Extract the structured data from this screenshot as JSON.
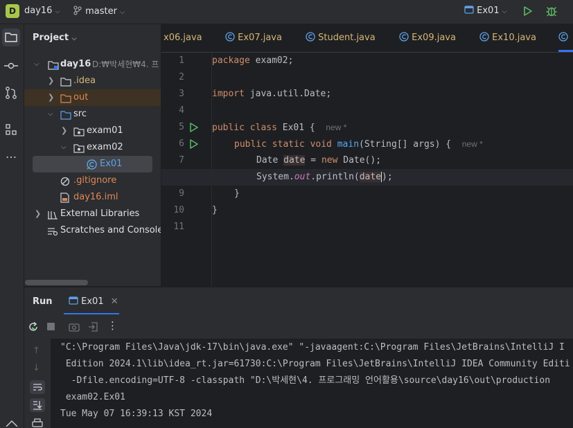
{
  "titlebar": {
    "project_badge": "D",
    "project_name": "day16",
    "branch": "master",
    "run_config": "Ex01"
  },
  "project_panel": {
    "title": "Project",
    "tree": [
      {
        "label": "day16",
        "path_hint": "D:₩박세현₩4. 프",
        "icon": "module-folder-icon"
      },
      {
        "label": ".idea",
        "icon": "folder-icon"
      },
      {
        "label": "out",
        "icon": "folder-icon"
      },
      {
        "label": "src",
        "icon": "folder-icon"
      },
      {
        "label": "exam01",
        "icon": "package-icon"
      },
      {
        "label": "exam02",
        "icon": "package-icon"
      },
      {
        "label": "Ex01",
        "icon": "class-icon"
      },
      {
        "label": ".gitignore",
        "icon": "ignore-file-icon"
      },
      {
        "label": "day16.iml",
        "icon": "iml-file-icon"
      },
      {
        "label": "External Libraries",
        "icon": "library-icon"
      },
      {
        "label": "Scratches and Consoles",
        "icon": "scratches-icon"
      }
    ]
  },
  "editor": {
    "tabs": [
      "x06.java",
      "Ex07.java",
      "Student.java",
      "Ex09.java",
      "Ex10.java"
    ],
    "line_numbers": [
      "1",
      "2",
      "3",
      "4",
      "5",
      "6",
      "7",
      "8",
      "9",
      "10",
      "11"
    ],
    "code": {
      "l1_kw": "package",
      "l1_rest": " exam02;",
      "l3_kw": "import",
      "l3_rest": " java.util.Date;",
      "l5_kw": "public class",
      "l5_rest": " Ex01 {",
      "l5_hint": "new *",
      "l6_kw": "public static void",
      "l6_fn": "main",
      "l6_rest": "(String[] args) {",
      "l6_hint": "new *",
      "l7_a": "Date ",
      "l7_var": "date",
      "l7_b": " = ",
      "l7_kw": "new",
      "l7_c": " Date();",
      "l8_a": "System.",
      "l8_out": "out",
      "l8_b": ".println(",
      "l8_var": "date",
      "l8_c": ");",
      "l9": "}",
      "l10": "}"
    }
  },
  "run_panel": {
    "title": "Run",
    "tab": "Ex01",
    "console": [
      "\"C:\\Program Files\\Java\\jdk-17\\bin\\java.exe\" \"-javaagent:C:\\Program Files\\JetBrains\\IntelliJ I",
      " Edition 2024.1\\lib\\idea_rt.jar=61730:C:\\Program Files\\JetBrains\\IntelliJ IDEA Community Editi",
      "  -Dfile.encoding=UTF-8 -classpath \"D:\\박세현\\4. 프로그래밍 언어활용\\source\\day16\\out\\production",
      " exam02.Ex01",
      "Tue May 07 16:39:13 KST 2024"
    ]
  },
  "colors": {
    "accent": "#3574f0",
    "run_green": "#5fb865",
    "keyword": "#cf8e6d",
    "function": "#56a8f5"
  }
}
